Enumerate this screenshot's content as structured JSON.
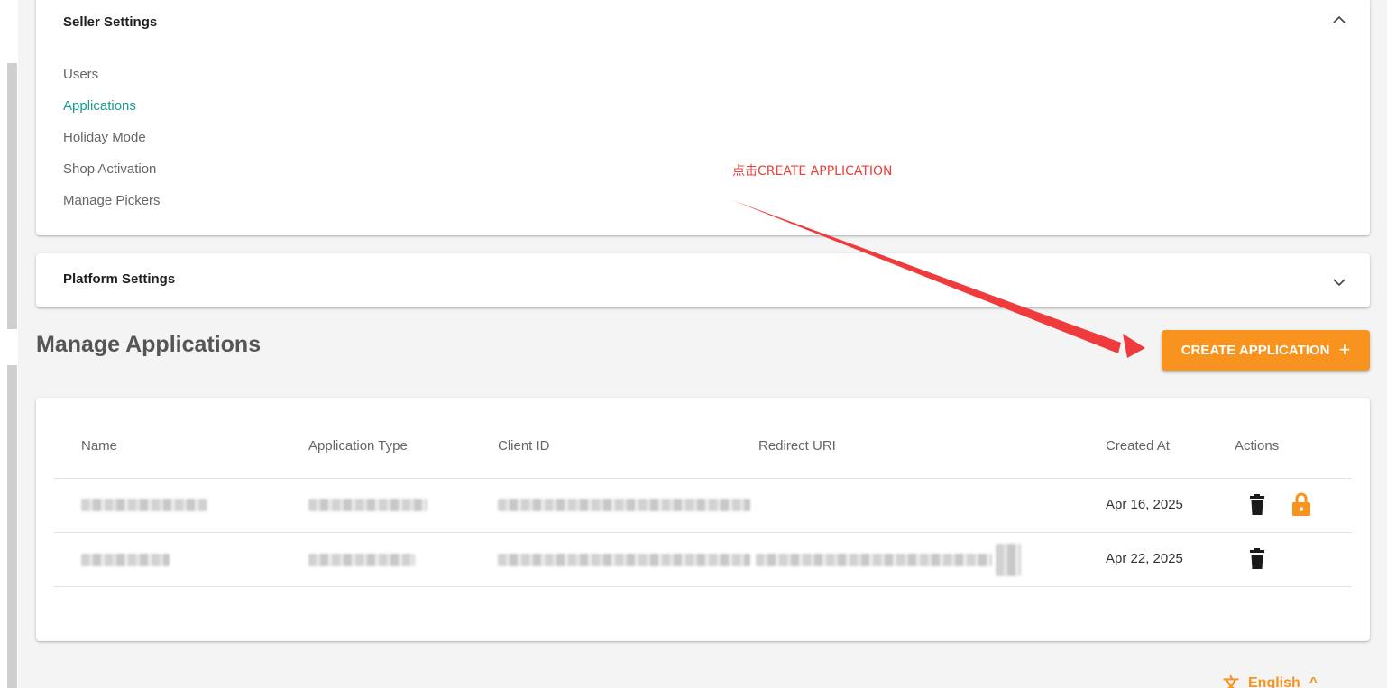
{
  "seller_settings": {
    "title": "Seller Settings",
    "items": [
      {
        "label": "Users",
        "active": false
      },
      {
        "label": "Applications",
        "active": true
      },
      {
        "label": "Holiday Mode",
        "active": false
      },
      {
        "label": "Shop Activation",
        "active": false
      },
      {
        "label": "Manage Pickers",
        "active": false
      }
    ]
  },
  "platform_settings": {
    "title": "Platform Settings"
  },
  "manage": {
    "title": "Manage Applications",
    "create_label": "CREATE APPLICATION"
  },
  "table": {
    "headers": {
      "name": "Name",
      "type": "Application Type",
      "client_id": "Client ID",
      "redirect_uri": "Redirect URI",
      "created_at": "Created At",
      "actions": "Actions"
    },
    "rows": [
      {
        "created_at": "Apr 16, 2025",
        "actions": [
          "delete",
          "lock"
        ]
      },
      {
        "created_at": "Apr 22, 2025",
        "actions": [
          "delete"
        ]
      }
    ]
  },
  "annotation": {
    "text": "点击CREATE APPLICATION"
  },
  "language": {
    "label": "English"
  },
  "colors": {
    "accent": "#f7931e",
    "active_link": "#1a9b91",
    "annotation": "#e8413c"
  }
}
